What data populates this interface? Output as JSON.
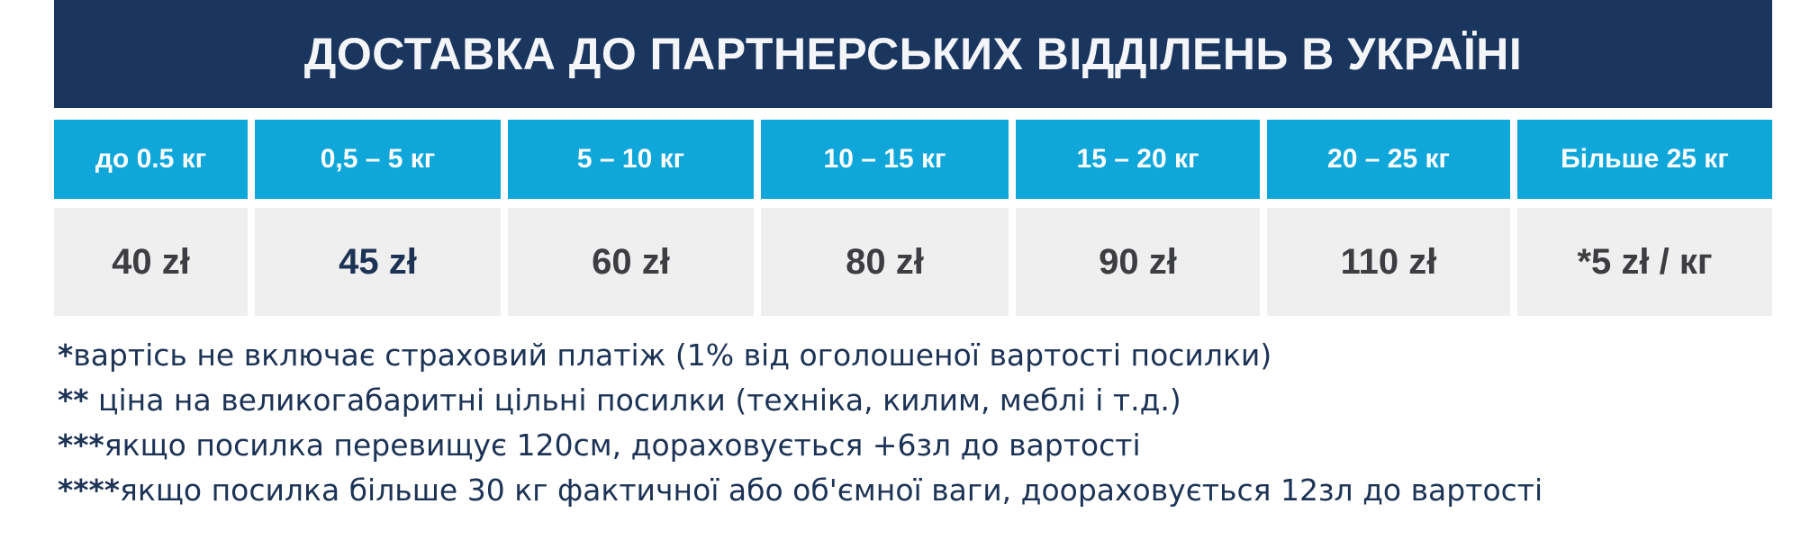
{
  "banner": {
    "title": "ДОСТАВКА ДО ПАРТНЕРСЬКИХ ВІДДІЛЕНЬ В УКРАЇНІ"
  },
  "table": {
    "columns": [
      {
        "weight": "до 0.5 кг",
        "price": "40 zł"
      },
      {
        "weight": "0,5 – 5 кг",
        "price": "45 zł"
      },
      {
        "weight": "5 – 10 кг",
        "price": "60 zł"
      },
      {
        "weight": "10 – 15 кг",
        "price": "80 zł"
      },
      {
        "weight": "15 – 20 кг",
        "price": "90 zł"
      },
      {
        "weight": "20 – 25 кг",
        "price": "110 zł"
      },
      {
        "weight": "Більше 25 кг",
        "price": "*5 zł / кг"
      }
    ]
  },
  "notes": [
    {
      "mark": "*",
      "text": "вартісь не включає страховий платіж (1% від оголошеної вартості посилки)"
    },
    {
      "mark": "**",
      "text": " ціна на великогабаритні цільні посилки (техніка, килим, меблі і т.д.)"
    },
    {
      "mark": "***",
      "text": "якщо посилка перевищує 120см, дораховується +6зл до вартості"
    },
    {
      "mark": "****",
      "text": "якщо посилка більше 30 кг фактичної або об'ємної ваги, доораховується 12зл до вартості"
    }
  ],
  "colors": {
    "banner_bg": "#1b365e",
    "header_bg": "#0fa6da",
    "price_bg": "#efefef",
    "notes_text": "#1d3355"
  }
}
